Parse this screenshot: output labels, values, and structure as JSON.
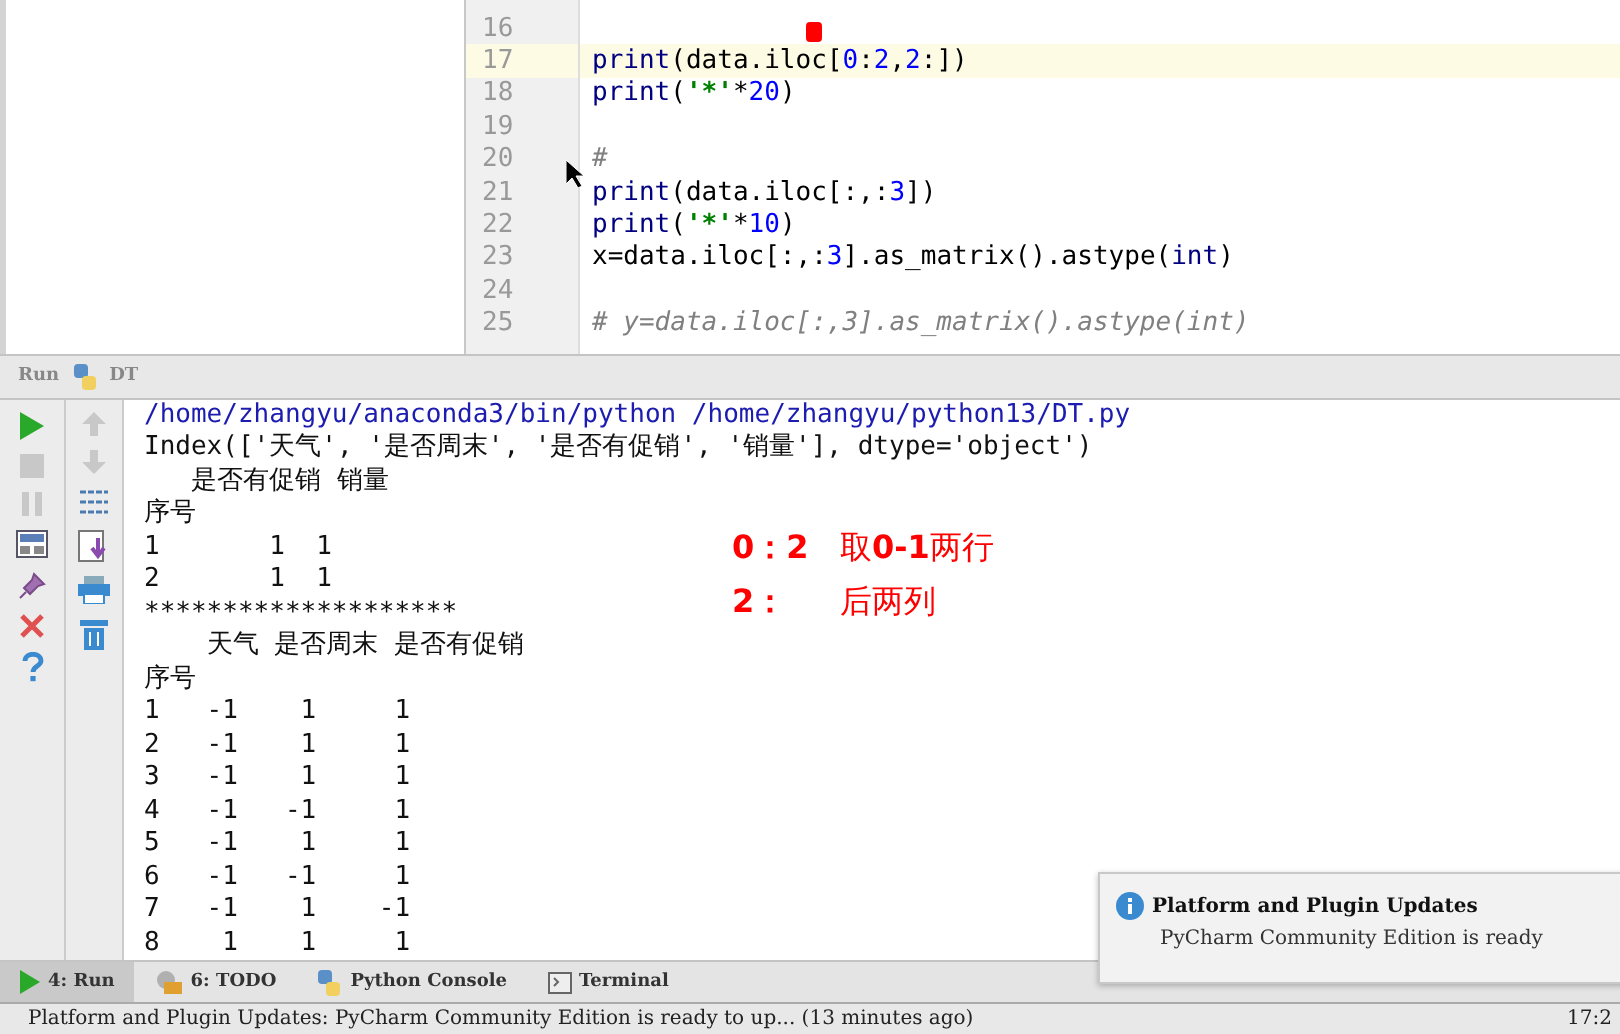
{
  "editor": {
    "lines": [
      {
        "number": "16",
        "current": false
      },
      {
        "number": "17",
        "current": true,
        "tokens": [
          {
            "kind": "keyword",
            "text": "print"
          },
          {
            "kind": "plain",
            "text": "(data.iloc["
          },
          {
            "kind": "number",
            "text": "0"
          },
          {
            "kind": "plain",
            "text": ":"
          },
          {
            "kind": "number",
            "text": "2"
          },
          {
            "kind": "plain",
            "text": ","
          },
          {
            "kind": "number",
            "text": "2"
          },
          {
            "kind": "plain",
            "text": ":])"
          }
        ]
      },
      {
        "number": "18",
        "current": false,
        "tokens": [
          {
            "kind": "keyword",
            "text": "print"
          },
          {
            "kind": "plain",
            "text": "("
          },
          {
            "kind": "string",
            "text": "'*'"
          },
          {
            "kind": "plain",
            "text": "*"
          },
          {
            "kind": "number",
            "text": "20"
          },
          {
            "kind": "plain",
            "text": ")"
          }
        ]
      },
      {
        "number": "19",
        "current": false
      },
      {
        "number": "20",
        "current": false,
        "tokens": [
          {
            "kind": "comment",
            "text": "#"
          }
        ]
      },
      {
        "number": "21",
        "current": false,
        "tokens": [
          {
            "kind": "keyword",
            "text": "print"
          },
          {
            "kind": "plain",
            "text": "(data.iloc[:,:"
          },
          {
            "kind": "number",
            "text": "3"
          },
          {
            "kind": "plain",
            "text": "])"
          }
        ]
      },
      {
        "number": "22",
        "current": false,
        "tokens": [
          {
            "kind": "keyword",
            "text": "print"
          },
          {
            "kind": "plain",
            "text": "("
          },
          {
            "kind": "string",
            "text": "'*'"
          },
          {
            "kind": "plain",
            "text": "*"
          },
          {
            "kind": "number",
            "text": "10"
          },
          {
            "kind": "plain",
            "text": ")"
          }
        ]
      },
      {
        "number": "23",
        "current": false,
        "tokens": [
          {
            "kind": "plain",
            "text": "x=data.iloc[:,:"
          },
          {
            "kind": "number",
            "text": "3"
          },
          {
            "kind": "plain",
            "text": "].as_matrix().astype("
          },
          {
            "kind": "keyword",
            "text": "int"
          },
          {
            "kind": "plain",
            "text": ")"
          }
        ]
      },
      {
        "number": "24",
        "current": false
      },
      {
        "number": "25",
        "current": false,
        "tokens": [
          {
            "kind": "comment",
            "text": "# y=data.iloc[:,3].as_matrix().astype(int)"
          }
        ]
      }
    ]
  },
  "run_header": {
    "label": "Run",
    "config": "DT"
  },
  "console": {
    "lines": [
      {
        "kind": "path",
        "text": "/home/zhangyu/anaconda3/bin/python /home/zhangyu/python13/DT.py"
      },
      {
        "kind": "output",
        "text": "Index(['天气', '是否周末', '是否有促销', '销量'], dtype='object')"
      },
      {
        "kind": "output",
        "text": "   是否有促销 销量"
      },
      {
        "kind": "output",
        "text": "序号"
      },
      {
        "kind": "output",
        "text": "1       1  1"
      },
      {
        "kind": "output",
        "text": "2       1  1"
      },
      {
        "kind": "output",
        "text": "********************"
      },
      {
        "kind": "output",
        "text": "    天气 是否周末 是否有促销"
      },
      {
        "kind": "output",
        "text": "序号"
      },
      {
        "kind": "output",
        "text": "1   -1    1     1"
      },
      {
        "kind": "output",
        "text": "2   -1    1     1"
      },
      {
        "kind": "output",
        "text": "3   -1    1     1"
      },
      {
        "kind": "output",
        "text": "4   -1   -1     1"
      },
      {
        "kind": "output",
        "text": "5   -1    1     1"
      },
      {
        "kind": "output",
        "text": "6   -1   -1     1"
      },
      {
        "kind": "output",
        "text": "7   -1    1    -1"
      },
      {
        "kind": "output",
        "text": "8    1    1     1"
      }
    ]
  },
  "annotations": [
    {
      "key": "0：2",
      "note": "取**0-1**两行"
    },
    {
      "key": "2：",
      "note": "后两列"
    }
  ],
  "bottom_tabs": [
    {
      "label": "4: Run",
      "selected": true
    },
    {
      "label": "6: TODO",
      "selected": false
    },
    {
      "label": "Python Console",
      "selected": false
    },
    {
      "label": "Terminal",
      "selected": false
    }
  ],
  "notification": {
    "title": "Platform and Plugin Updates",
    "body": "PyCharm Community Edition is ready"
  },
  "status_bar": {
    "message": "Platform and Plugin Updates: PyCharm Community Edition is ready to up... (13 minutes ago)",
    "time": "17:2"
  }
}
